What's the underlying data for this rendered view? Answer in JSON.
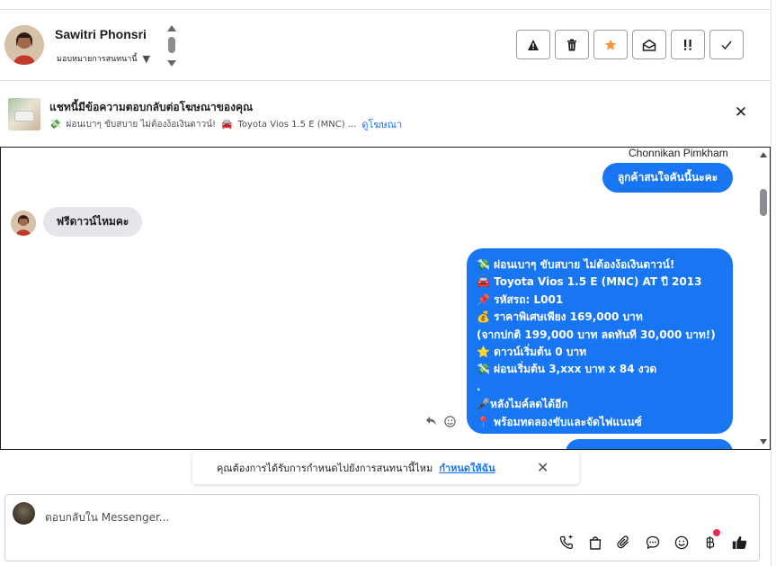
{
  "header": {
    "user_name": "Sawitri Phonsri",
    "assign_label": "มอบหมายการสนทนานี้",
    "actions": [
      {
        "name": "report-button",
        "glyph": "⚠"
      },
      {
        "name": "delete-button",
        "glyph": "🗑"
      },
      {
        "name": "star-button",
        "glyph": "★"
      },
      {
        "name": "mark-unread-button",
        "glyph": "✉"
      },
      {
        "name": "spam-button",
        "glyph": "!!"
      },
      {
        "name": "done-button",
        "glyph": "✓"
      }
    ]
  },
  "ad_banner": {
    "title": "แชทนี้มีข้อความตอบกลับต่อโฆษณาของคุณ",
    "subtitle_icon1": "💸",
    "subtitle_text": "ผ่อนเบาๆ ขับสบาย ไม่ต้องง้อเงินดาวน์!",
    "subtitle_icon2": "🚘",
    "subtitle_text2": "Toyota Vios 1.5 E (MNC) ...",
    "link": "ดูโฆษณา"
  },
  "chat": {
    "sender_name": "Chonnikan Pimkham",
    "msg_out_1": "ลูกค้าสนใจคันนี้นะคะ",
    "msg_in_1": "ฟรีดาวน์ไหมคะ",
    "msg_out_2_lines": [
      "💸 ผ่อนเบาๆ ขับสบาย ไม่ต้องง้อเงินดาวน์!",
      "🚘 Toyota Vios 1.5 E (MNC) AT ปี 2013",
      "📌 รหัสรถ: L001",
      "💰 ราคาพิเศษเพียง 169,000 บาท",
      "(จากปกติ 199,000 บาท ลดทันที 30,000 บาท!)",
      "⭐ ดาวน์เริ่มต้น 0 บาท",
      "💸 ผ่อนเริ่มต้น 3,xxx บาท x 84 งวด",
      ".",
      "🎤หลังไมค์ลดได้อีก",
      "📍 พร้อมทดลองขับและจัดไฟแนนซ์"
    ]
  },
  "notice": {
    "text": "คุณต้องการได้รับการกำหนดไปยังการสนทนานี้ไหม",
    "link": "กำหนดให้ฉัน"
  },
  "composer": {
    "placeholder": "ตอบกลับใน Messenger..."
  },
  "colors": {
    "accent": "#1876f2",
    "incoming_bubble": "#e4e6eb",
    "star": "#f7923a",
    "badge": "#f02849"
  }
}
